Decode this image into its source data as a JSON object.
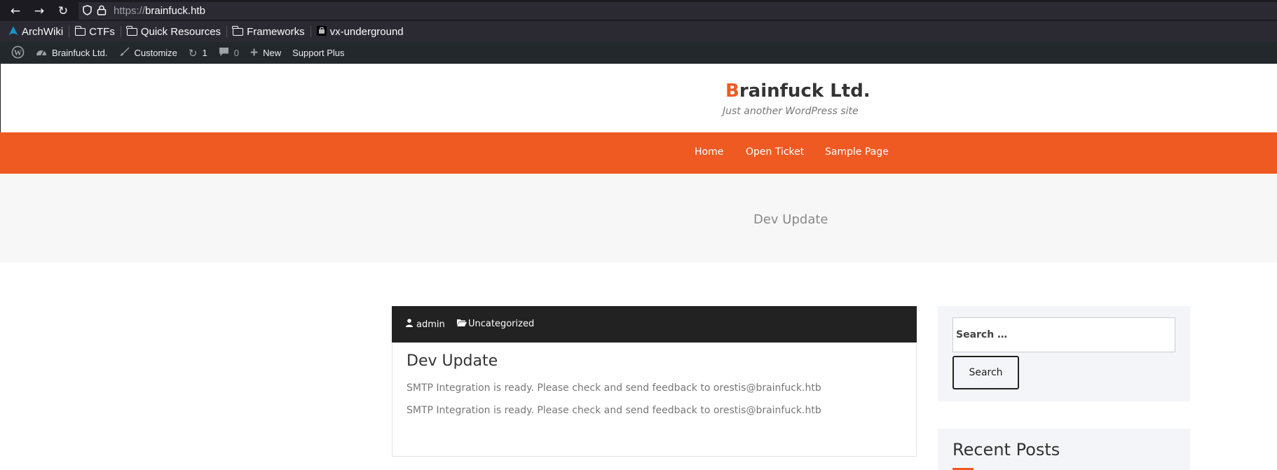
{
  "browser": {
    "url_scheme": "https://",
    "url_host": "brainfuck.htb",
    "bookmarks": [
      {
        "label": "ArchWiki",
        "icon": "arch-icon"
      },
      {
        "label": "CTFs",
        "icon": "folder-icon"
      },
      {
        "label": "Quick Resources",
        "icon": "folder-icon"
      },
      {
        "label": "Frameworks",
        "icon": "folder-icon"
      },
      {
        "label": "vx-underground",
        "icon": "vx-icon"
      }
    ]
  },
  "adminbar": {
    "site_name": "Brainfuck Ltd.",
    "customize": "Customize",
    "updates_count": "1",
    "comments_count": "0",
    "new_label": "New",
    "support_plus": "Support Plus"
  },
  "site": {
    "title_first": "B",
    "title_rest": "rainfuck Ltd.",
    "tagline": "Just another WordPress site",
    "accent_color": "#ef5a22"
  },
  "nav": {
    "items": [
      "Home",
      "Open Ticket",
      "Sample Page"
    ]
  },
  "banner": {
    "title": "Dev Update"
  },
  "post": {
    "author": "admin",
    "category": "Uncategorized",
    "title": "Dev Update",
    "paragraphs": [
      "SMTP Integration is ready. Please check and send feedback to orestis@brainfuck.htb",
      "SMTP Integration is ready. Please check and send feedback to orestis@brainfuck.htb"
    ]
  },
  "sidebar": {
    "search_placeholder": "Search …",
    "search_button": "Search",
    "recent_posts_heading": "Recent Posts"
  }
}
